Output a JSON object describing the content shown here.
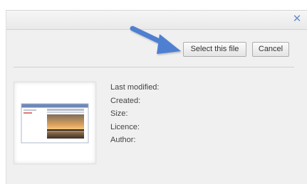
{
  "dialog": {
    "close_glyph": "✕",
    "buttons": {
      "select_label": "Select this file",
      "cancel_label": "Cancel"
    },
    "metadata": [
      {
        "label": "Last modified:"
      },
      {
        "label": "Created:"
      },
      {
        "label": "Size:"
      },
      {
        "label": "Licence:"
      },
      {
        "label": "Author:"
      }
    ]
  },
  "colors": {
    "arrow": "#4f7fd0",
    "close": "#6b8ec7",
    "dialog_bg": "#f0f0f0"
  },
  "icons": {
    "close": "close-icon",
    "arrow": "pointer-arrow-icon"
  }
}
